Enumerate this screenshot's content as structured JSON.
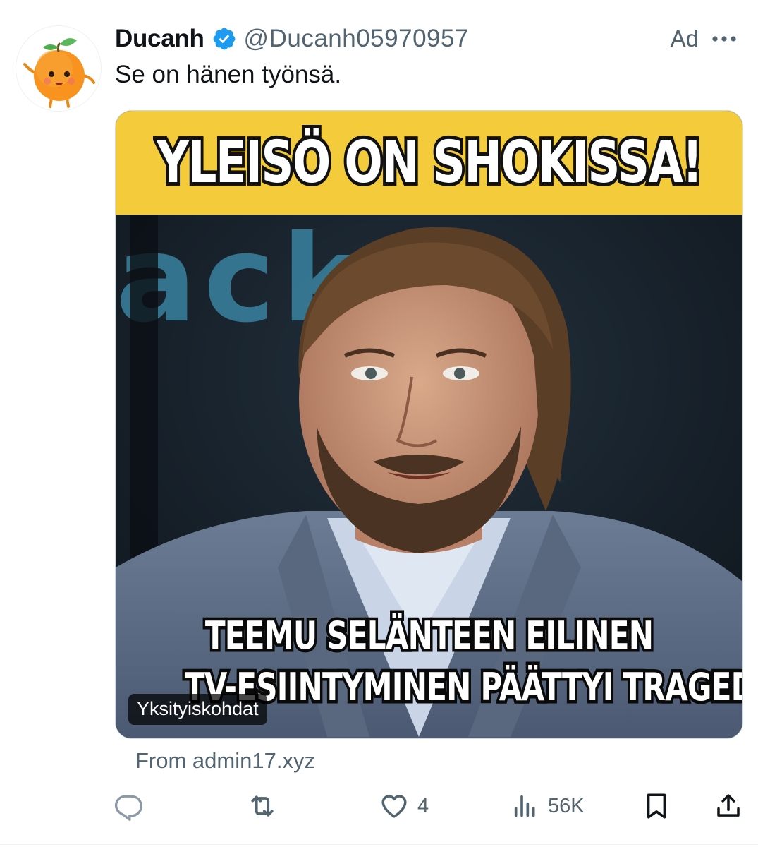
{
  "tweet": {
    "display_name": "Ducanh",
    "handle": "@Ducanh05970957",
    "ad_label": "Ad",
    "text": "Se on hänen työnsä.",
    "verified": true
  },
  "media": {
    "headline": "YLEISÖ ON SHOKISSA!",
    "caption_line_1": "TEEMU SELÄNTEEN EILINEN",
    "caption_line_2": "TV-ESIINTYMINEN  PÄÄTTYI TRAGEDIAAN!",
    "privacy_badge": "Yksityiskohdat",
    "banner_color": "#f4cb3a"
  },
  "source": "From admin17.xyz",
  "actions": {
    "reply": {
      "icon": "reply-icon",
      "count": ""
    },
    "repost": {
      "icon": "repost-icon",
      "count": ""
    },
    "like": {
      "icon": "heart-icon",
      "count": "4"
    },
    "views": {
      "icon": "views-icon",
      "count": "56K"
    },
    "bookmark": {
      "icon": "bookmark-icon"
    },
    "share": {
      "icon": "share-icon"
    }
  },
  "colors": {
    "text_primary": "#0f1419",
    "text_secondary": "#536471",
    "verified_blue": "#1d9bf0"
  }
}
